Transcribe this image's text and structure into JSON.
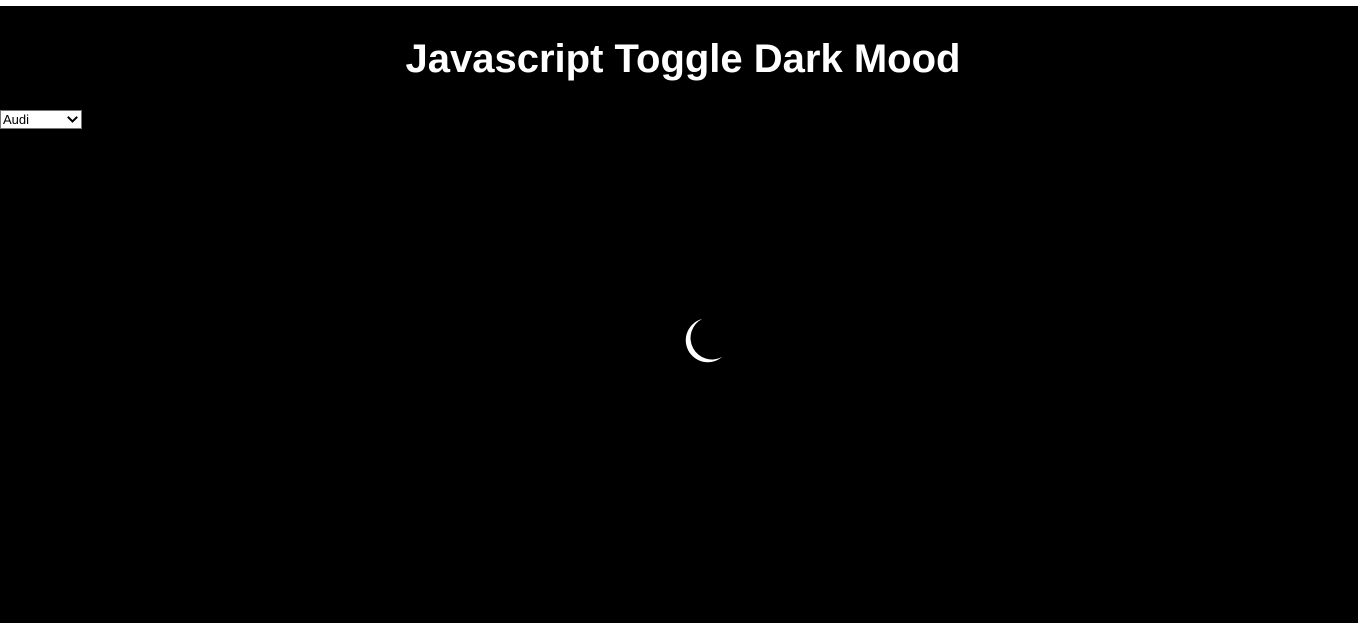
{
  "page": {
    "title": "Javascript Toggle Dark Mood"
  },
  "car_select": {
    "selected": "Audi"
  },
  "theme_toggle": {
    "icon": "moon-icon",
    "mode": "dark"
  },
  "colors": {
    "background": "#000000",
    "text": "#ffffff"
  }
}
